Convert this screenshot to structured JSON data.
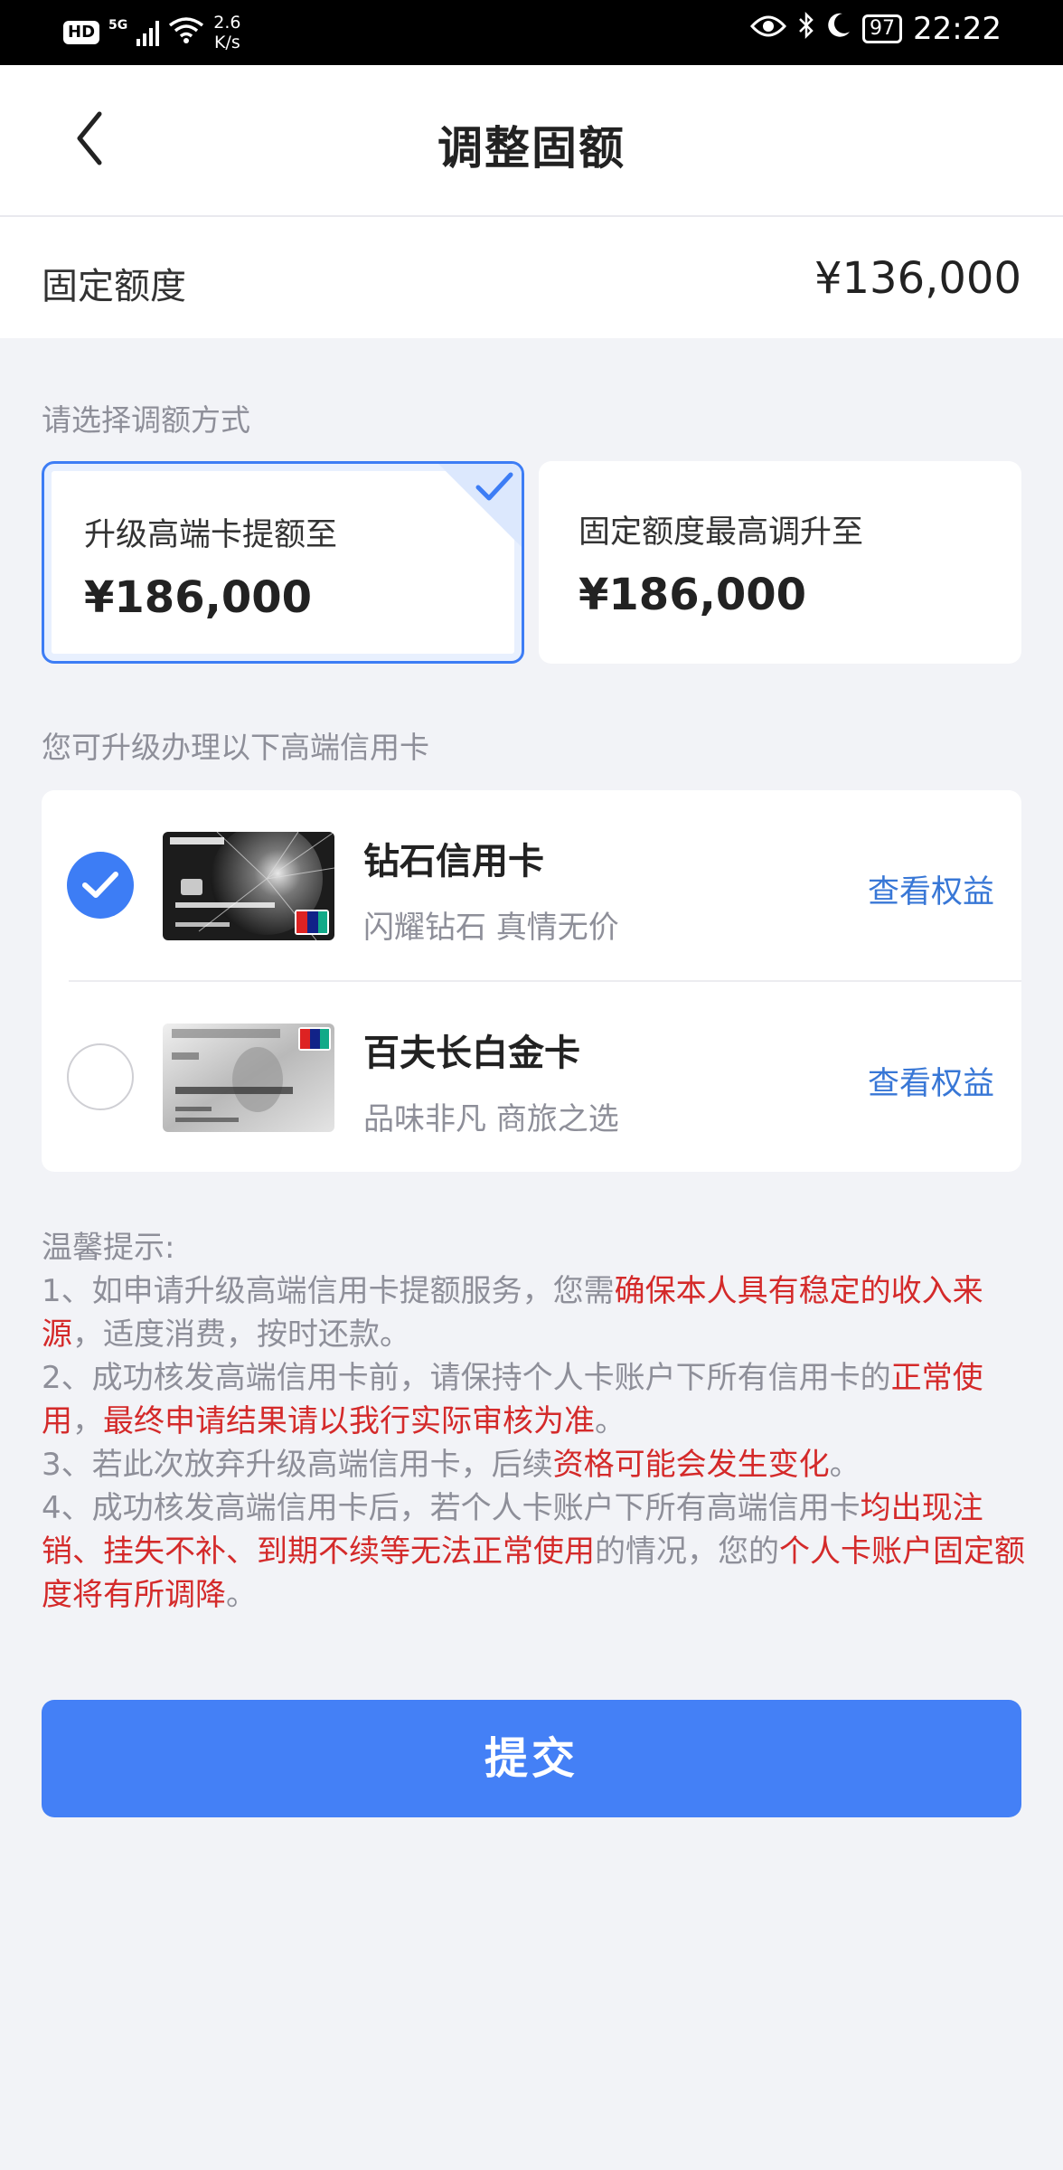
{
  "status_bar": {
    "hd": "HD",
    "network": "5G",
    "speed_value": "2.6",
    "speed_unit": "K/s",
    "battery": "97",
    "time": "22:22"
  },
  "header": {
    "title": "调整固额"
  },
  "quota": {
    "label": "固定额度",
    "value": "¥136,000"
  },
  "choose_label": "请选择调额方式",
  "options": [
    {
      "title": "升级高端卡提额至",
      "value": "¥186,000",
      "selected": true
    },
    {
      "title": "固定额度最高调升至",
      "value": "¥186,000",
      "selected": false
    }
  ],
  "cards_label": "您可升级办理以下高端信用卡",
  "cards": [
    {
      "name": "钻石信用卡",
      "desc": "闪耀钻石 真情无价",
      "link": "查看权益",
      "selected": true
    },
    {
      "name": "百夫长白金卡",
      "desc": "品味非凡 商旅之选",
      "link": "查看权益",
      "selected": false
    }
  ],
  "tips": {
    "heading": "温馨提示:",
    "items": [
      [
        {
          "text": "1、如申请升级高端信用卡提额服务，您需",
          "red": false
        },
        {
          "text": "确保本人具有稳定的收入来源",
          "red": true
        },
        {
          "text": "，适度消费，按时还款。",
          "red": false
        }
      ],
      [
        {
          "text": "2、成功核发高端信用卡前，请保持个人卡账户下所有信用卡的",
          "red": false
        },
        {
          "text": "正常使用",
          "red": true
        },
        {
          "text": "，",
          "red": false
        },
        {
          "text": "最终申请结果请以我行实际审核为准",
          "red": true
        },
        {
          "text": "。",
          "red": false
        }
      ],
      [
        {
          "text": "3、若此次放弃升级高端信用卡，后续",
          "red": false
        },
        {
          "text": "资格可能会发生变化",
          "red": true
        },
        {
          "text": "。",
          "red": false
        }
      ],
      [
        {
          "text": "4、成功核发高端信用卡后，若个人卡账户下所有高端信用卡",
          "red": false
        },
        {
          "text": "均出现注销、挂失不补、到期不续等无法正常使用",
          "red": true
        },
        {
          "text": "的情况，您的",
          "red": false
        },
        {
          "text": "个人卡账户固定额度将有所调降",
          "red": true
        },
        {
          "text": "。",
          "red": false
        }
      ]
    ]
  },
  "submit_label": "提交",
  "colors": {
    "accent": "#3d7df5",
    "button": "#4480f6",
    "link": "#3877d6",
    "warning": "#d42a2a"
  }
}
